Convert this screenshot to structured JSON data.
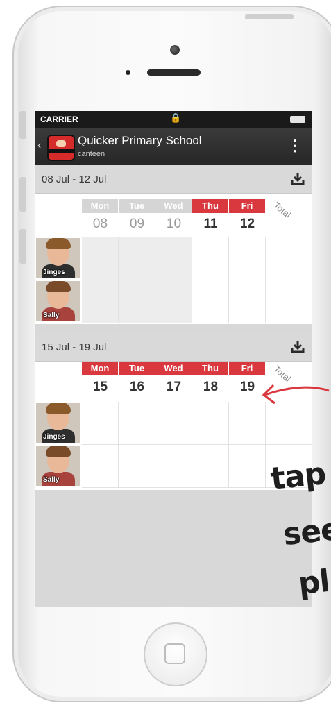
{
  "statusbar": {
    "carrier": "CARRIER"
  },
  "appbar": {
    "title": "Quicker Primary School",
    "subtitle": "canteen"
  },
  "colors": {
    "accent_red": "#d9393e",
    "disabled_day": "#d5d5d5"
  },
  "weeks": [
    {
      "range": "08 Jul - 12 Jul",
      "total_label": "Total",
      "days": [
        {
          "name": "Mon",
          "num": "08",
          "active": false
        },
        {
          "name": "Tue",
          "num": "09",
          "active": false
        },
        {
          "name": "Wed",
          "num": "10",
          "active": false
        },
        {
          "name": "Thu",
          "num": "11",
          "active": true
        },
        {
          "name": "Fri",
          "num": "12",
          "active": true
        }
      ],
      "children": [
        {
          "name": "Jinges"
        },
        {
          "name": "Sally"
        }
      ]
    },
    {
      "range": "15 Jul - 19 Jul",
      "total_label": "Total",
      "days": [
        {
          "name": "Mon",
          "num": "15",
          "active": true
        },
        {
          "name": "Tue",
          "num": "16",
          "active": true
        },
        {
          "name": "Wed",
          "num": "17",
          "active": true
        },
        {
          "name": "Thu",
          "num": "18",
          "active": true
        },
        {
          "name": "Fri",
          "num": "19",
          "active": true
        }
      ],
      "children": [
        {
          "name": "Jinges"
        },
        {
          "name": "Sally"
        }
      ]
    }
  ],
  "annotation": {
    "line1": "tap",
    "line2": "see",
    "line3": "pl"
  }
}
